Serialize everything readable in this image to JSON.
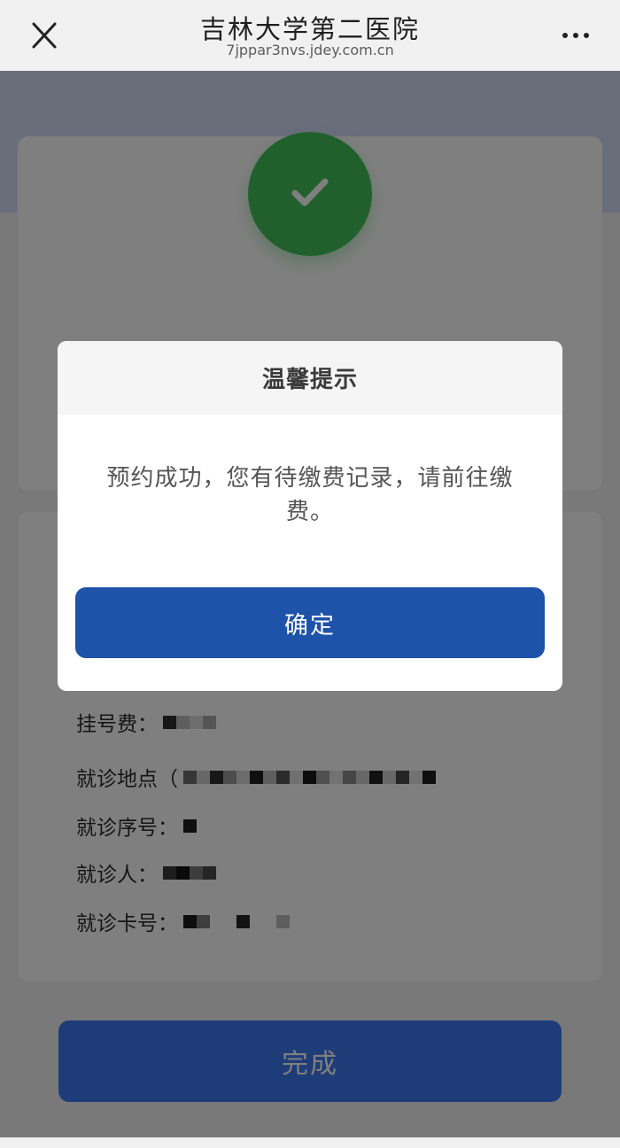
{
  "navbar": {
    "title": "吉林大学第二医院",
    "subtitle": "7jppar3nvs.jdey.com.cn",
    "close_icon": "close-icon",
    "more_icon": "more-icon"
  },
  "status": {
    "icon": "checkmark-icon",
    "color": "#43c15a"
  },
  "info": {
    "fee_label": "挂号费：",
    "location_label": "就诊地点（",
    "sequence_label": "就诊序号：",
    "patient_label": "就诊人：",
    "card_label": "就诊卡号："
  },
  "done_button": {
    "label": "完成"
  },
  "dialog": {
    "title": "温馨提示",
    "message": "预约成功，您有待缴费记录，请前往缴费。",
    "confirm_label": "确定"
  },
  "colors": {
    "accent": "#1d53a8",
    "success": "#43c15a"
  }
}
